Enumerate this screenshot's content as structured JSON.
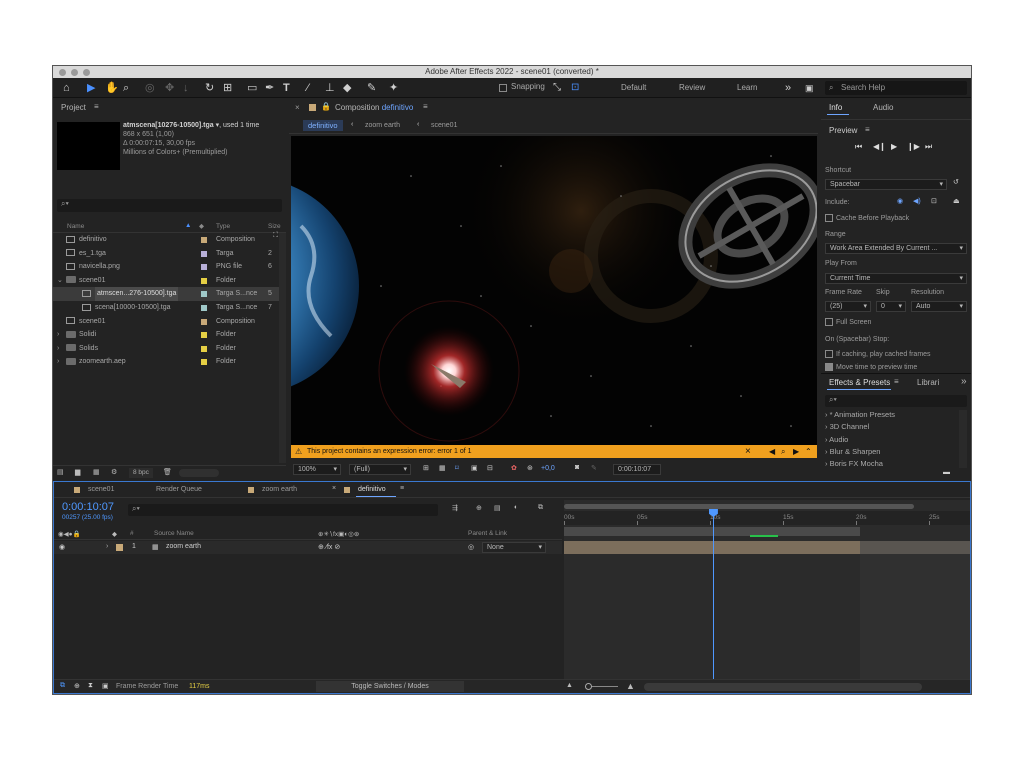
{
  "window": {
    "title": "Adobe After Effects 2022 - scene01 (converted) *"
  },
  "toolbar": {
    "snapping": "Snapping",
    "workspaces": [
      "Default",
      "Review",
      "Learn"
    ],
    "more": "»",
    "search_placeholder": "Search Help"
  },
  "project": {
    "tab": "Project",
    "menu": "≡",
    "selected_name": "atmscena[10276-10500].tga",
    "selected_used": ", used 1 time",
    "info_lines": [
      "868 x 651 (1,00)",
      "Δ 0:00:07:15, 30,00 fps",
      "Millions of Colors+ (Premultiplied)"
    ],
    "search_placeholder": "",
    "columns": {
      "name": "Name",
      "type": "Type",
      "size": "Size"
    },
    "rows": [
      {
        "name": "definitivo",
        "type": "Composition",
        "size": "",
        "color": "#c8a978",
        "icon": "composition",
        "indent": 0
      },
      {
        "name": "es_1.tga",
        "type": "Targa",
        "size": "2",
        "color": "#b8b0d8",
        "icon": "file",
        "indent": 0
      },
      {
        "name": "navicella.png",
        "type": "PNG file",
        "size": "6",
        "color": "#b8b0d8",
        "icon": "file",
        "indent": 0
      },
      {
        "name": "scene01",
        "type": "Folder",
        "size": "",
        "color": "#e5cf44",
        "icon": "folder",
        "indent": 0,
        "open": true
      },
      {
        "name": "atmscen...276-10500].tga",
        "type": "Targa S...nce",
        "size": "5",
        "color": "#9fc8c8",
        "icon": "sequence",
        "indent": 1,
        "selected": true
      },
      {
        "name": "scena[10000-10500].tga",
        "type": "Targa S...nce",
        "size": "7",
        "color": "#9fc8c8",
        "icon": "sequence",
        "indent": 1
      },
      {
        "name": "scene01",
        "type": "Composition",
        "size": "",
        "color": "#c8a978",
        "icon": "composition",
        "indent": 0
      },
      {
        "name": "Solidi",
        "type": "Folder",
        "size": "",
        "color": "#e5cf44",
        "icon": "folder",
        "indent": 0
      },
      {
        "name": "Solids",
        "type": "Folder",
        "size": "",
        "color": "#e5cf44",
        "icon": "folder",
        "indent": 0
      },
      {
        "name": "zoomearth.aep",
        "type": "Folder",
        "size": "",
        "color": "#e5cf44",
        "icon": "folder",
        "indent": 0
      }
    ],
    "bpc": "8 bpc"
  },
  "composition": {
    "tab_prefix": "Composition",
    "tab_name": "definitivo",
    "menu": "≡",
    "breadcrumbs": [
      "definitivo",
      "zoom earth",
      "scene01"
    ],
    "error": "This project contains an expression error: error 1 of 1",
    "zoom": "100%",
    "resolution": "(Full)",
    "exposure": "+0,0",
    "timecode": "0:00:10:07"
  },
  "info_panel": {
    "tabs": [
      "Info",
      "Audio"
    ],
    "preview_title": "Preview",
    "preview_menu": "≡",
    "shortcut_label": "Shortcut",
    "shortcut_value": "Spacebar",
    "include_label": "Include:",
    "cache_label": "Cache Before Playback",
    "range_label": "Range",
    "range_value": "Work Area Extended By Current ...",
    "play_from_label": "Play From",
    "play_from_value": "Current Time",
    "frame_rate_label": "Frame Rate",
    "skip_label": "Skip",
    "resolution_label": "Resolution",
    "frame_rate_value": "(25)",
    "skip_value": "0",
    "resolution_value": "Auto",
    "full_screen": "Full Screen",
    "stop_label": "On (Spacebar) Stop:",
    "stop_option1": "If caching, play cached frames",
    "stop_option2": "Move time to preview time"
  },
  "effects": {
    "tabs": [
      "Effects & Presets",
      "Librari"
    ],
    "menu": "≡",
    "more": "»",
    "search_placeholder": "",
    "items": [
      "* Animation Presets",
      "3D Channel",
      "Audio",
      "Blur & Sharpen",
      "Boris FX Mocha"
    ]
  },
  "timeline": {
    "tabs": [
      "scene01",
      "Render Queue",
      "zoom earth",
      "definitivo"
    ],
    "active_tab": "definitivo",
    "menu": "≡",
    "time": "0:00:10:07",
    "time_sub": "00257 (25.00 fps)",
    "columns": {
      "source": "Source Name",
      "parent": "Parent & Link",
      "num": "#"
    },
    "layer": {
      "num": "1",
      "name": "zoom earth",
      "parent": "None"
    },
    "ruler": [
      "00s",
      "05s",
      "10s",
      "15s",
      "20s",
      "25s"
    ],
    "playhead_fraction": 0.408,
    "footer": {
      "frame_render_label": "Frame Render Time",
      "frame_render_value": "117ms",
      "toggle": "Toggle Switches / Modes"
    }
  }
}
